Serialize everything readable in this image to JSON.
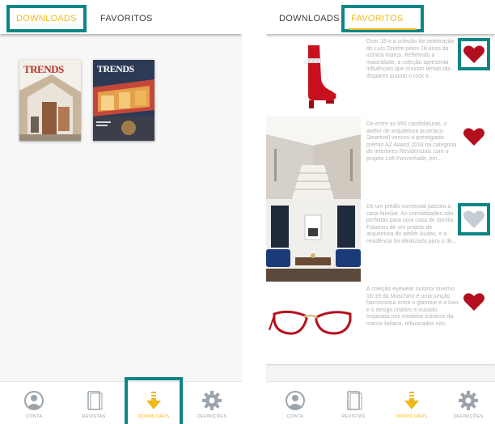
{
  "left": {
    "tabs": [
      {
        "label": "DOWNLOADS",
        "active": true
      },
      {
        "label": "FAVORITOS",
        "active": false
      }
    ],
    "magazines": [
      {
        "masthead": "TRENDS",
        "icon": "magazine-cover-1"
      },
      {
        "masthead": "TRENDS",
        "icon": "magazine-cover-2"
      }
    ],
    "nav": [
      {
        "label": "CONTA",
        "icon": "person-icon",
        "active": false
      },
      {
        "label": "REVISTAS",
        "icon": "magazine-icon",
        "active": false
      },
      {
        "label": "DOWNLOADS",
        "icon": "download-arrow-icon",
        "active": true
      },
      {
        "label": "DEFINIÇÕES",
        "icon": "gear-icon",
        "active": false
      }
    ]
  },
  "right": {
    "tabs": [
      {
        "label": "DOWNLOADS",
        "active": false
      },
      {
        "label": "FAVORITOS",
        "active": true
      }
    ],
    "items": [
      {
        "image": "red-boot-image",
        "text": "Over 18 é a coleção de cele­bração de Luís Onofre pelos 18 anos da icónica marca. Refletindo a maioridade, a coleção apresenta influên­cias que cruzam temas tão díspares quanto o rock e...",
        "favorite": true
      },
      {
        "image": "white-staircase-interior-image",
        "text": "De entre as 950 candidatu­ras, o atelier de arquitetura austríaco Smartvoll venceu o prestigiado prémio AZ Award 2018 na categoria de Inte­riores Residenciais com o pro­jeto Loft Panzerhalle, em...",
        "favorite": true
      },
      {
        "image": "living-room-interior-image",
        "text": "De um prédio comercial passou a casa familiar. As co­modidades são perfeitas para uma casa de família. Falamos de um projeto de arquitetura do atelier Audax, e a residên­cia foi idealizada para o dir...",
        "favorite": false
      },
      {
        "image": "red-eyeglasses-image",
        "text": "A coleção eyewear outono/ inverno 18-19 da Moschino é uma junção harmoniosa entre o glamour e o luxo e o design criativo e ousado. Inspirada nos modelos icónicos da mar­ca italiana, rebuscados nos...",
        "favorite": true
      }
    ],
    "nav": [
      {
        "label": "CONTA",
        "icon": "person-icon",
        "active": false
      },
      {
        "label": "REVISTAS",
        "icon": "magazine-icon",
        "active": false
      },
      {
        "label": "DOWNLOADS",
        "icon": "download-arrow-icon",
        "active": true
      },
      {
        "label": "DEFINIÇÕES",
        "icon": "gear-icon",
        "active": false
      }
    ]
  },
  "colors": {
    "accent": "#f1b81c",
    "highlight": "#0d8585",
    "heart_active": "#b30f1f",
    "heart_inactive": "#c5ced6",
    "nav_icon": "#9aa4ad"
  }
}
